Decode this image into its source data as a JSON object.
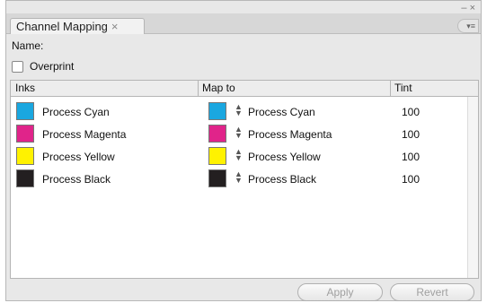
{
  "window": {
    "tab_title": "Channel Mapping",
    "tab_close_glyph": "×",
    "top_controls": "– ×",
    "menu_glyph": "▾≡"
  },
  "form": {
    "name_label": "Name:",
    "overprint_label": "Overprint",
    "overprint_checked": false
  },
  "table": {
    "columns": [
      "Inks",
      "Map to",
      "Tint"
    ],
    "rows": [
      {
        "ink": "Process Cyan",
        "ink_color": "#1aa7e0",
        "map_to": "Process Cyan",
        "map_color": "#1aa7e0",
        "tint": "100"
      },
      {
        "ink": "Process Magenta",
        "ink_color": "#e0248a",
        "map_to": "Process Magenta",
        "map_color": "#e0248a",
        "tint": "100"
      },
      {
        "ink": "Process Yellow",
        "ink_color": "#fff200",
        "map_to": "Process Yellow",
        "map_color": "#fff200",
        "tint": "100"
      },
      {
        "ink": "Process Black",
        "ink_color": "#231f20",
        "map_to": "Process Black",
        "map_color": "#231f20",
        "tint": "100"
      }
    ]
  },
  "buttons": {
    "apply": "Apply",
    "revert": "Revert"
  }
}
